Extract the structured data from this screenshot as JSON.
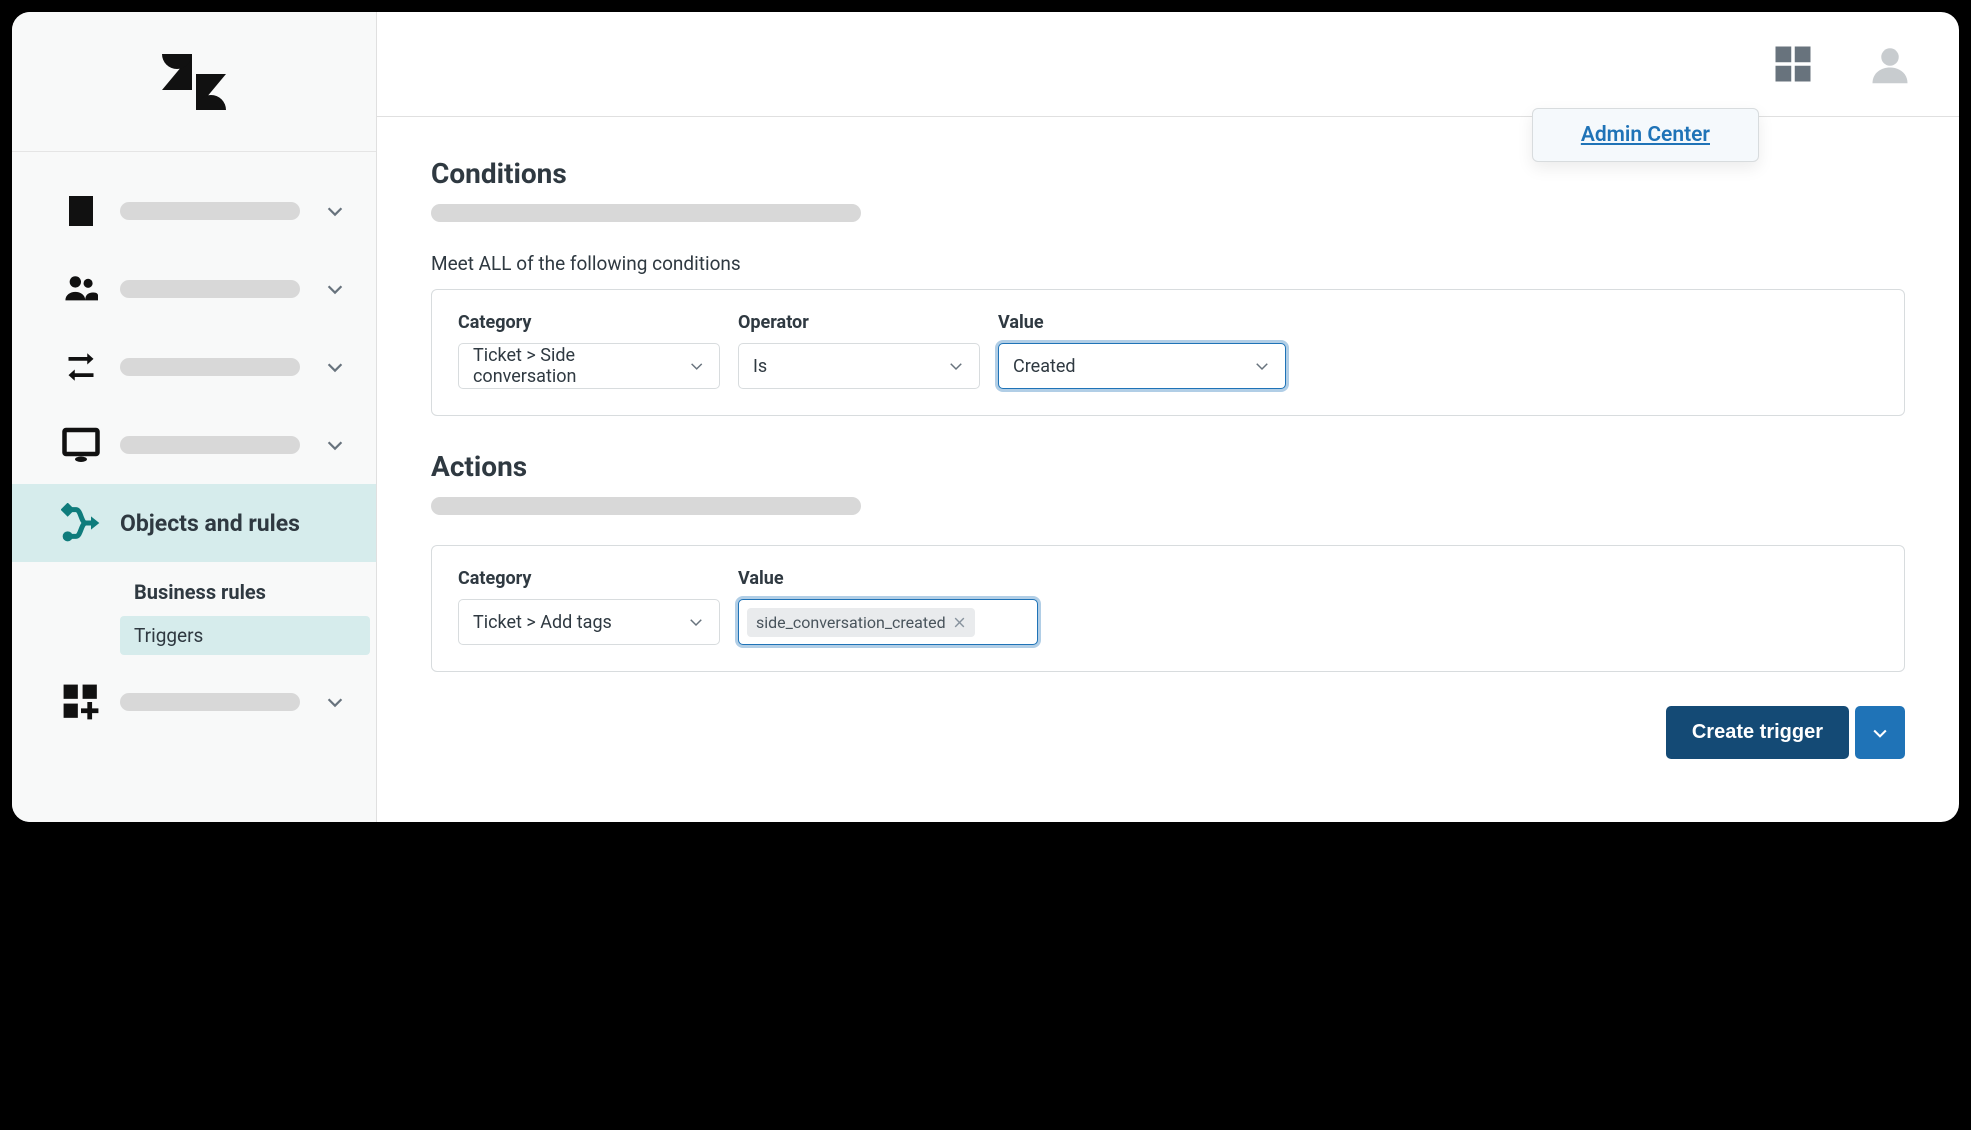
{
  "popup": {
    "link_text": "Admin Center"
  },
  "sidebar": {
    "active_label": "Objects and rules",
    "sub_heading": "Business rules",
    "sub_item": "Triggers"
  },
  "conditions": {
    "title": "Conditions",
    "meet_all": "Meet ALL of the following conditions",
    "labels": {
      "category": "Category",
      "operator": "Operator",
      "value": "Value"
    },
    "row": {
      "category": "Ticket > Side conversation",
      "operator": "Is",
      "value": "Created"
    }
  },
  "actions": {
    "title": "Actions",
    "labels": {
      "category": "Category",
      "value": "Value"
    },
    "row": {
      "category": "Ticket > Add tags",
      "tag": "side_conversation_created"
    }
  },
  "buttons": {
    "create": "Create trigger"
  }
}
